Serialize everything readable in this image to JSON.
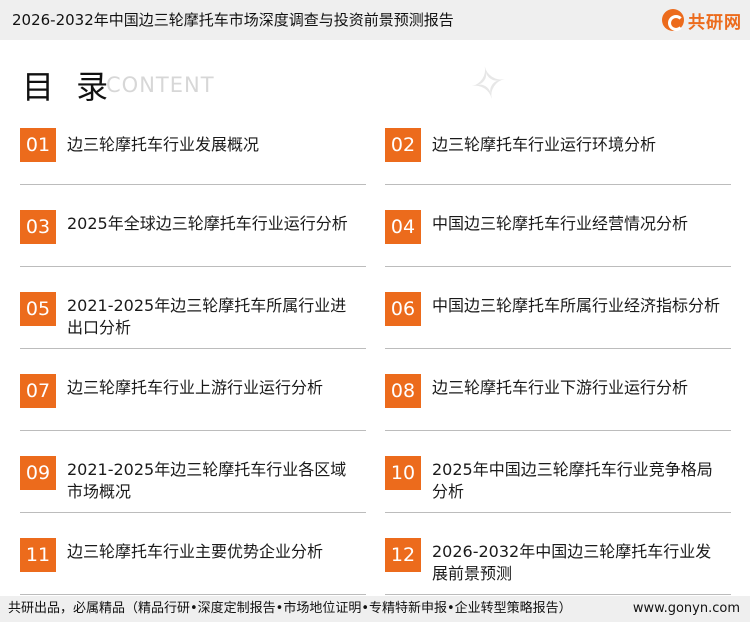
{
  "header": {
    "title": "2026-2032年中国边三轮摩托车市场深度调查与投资前景预测报告",
    "logo_text": "共研网",
    "accent_color": "#ec6b1c"
  },
  "toc": {
    "heading": "目 录",
    "subheading": "CONTENT",
    "items": [
      {
        "num": "01",
        "label": "边三轮摩托车行业发展概况"
      },
      {
        "num": "02",
        "label": "边三轮摩托车行业运行环境分析"
      },
      {
        "num": "03",
        "label": "2025年全球边三轮摩托车行业运行分析"
      },
      {
        "num": "04",
        "label": "中国边三轮摩托车行业经营情况分析"
      },
      {
        "num": "05",
        "label": "2021-2025年边三轮摩托车所属行业进出口分析"
      },
      {
        "num": "06",
        "label": "中国边三轮摩托车所属行业经济指标分析"
      },
      {
        "num": "07",
        "label": "边三轮摩托车行业上游行业运行分析"
      },
      {
        "num": "08",
        "label": "边三轮摩托车行业下游行业运行分析"
      },
      {
        "num": "09",
        "label": "2021-2025年边三轮摩托车行业各区域市场概况"
      },
      {
        "num": "10",
        "label": "2025年中国边三轮摩托车行业竞争格局分析"
      },
      {
        "num": "11",
        "label": "边三轮摩托车行业主要优势企业分析"
      },
      {
        "num": "12",
        "label": "2026-2032年中国边三轮摩托车行业发展前景预测"
      }
    ]
  },
  "footer": {
    "left": "共研出品，必属精品（精品行研•深度定制报告•市场地位证明•专精特新申报•企业转型策略报告）",
    "right": "www.gonyn.com"
  }
}
